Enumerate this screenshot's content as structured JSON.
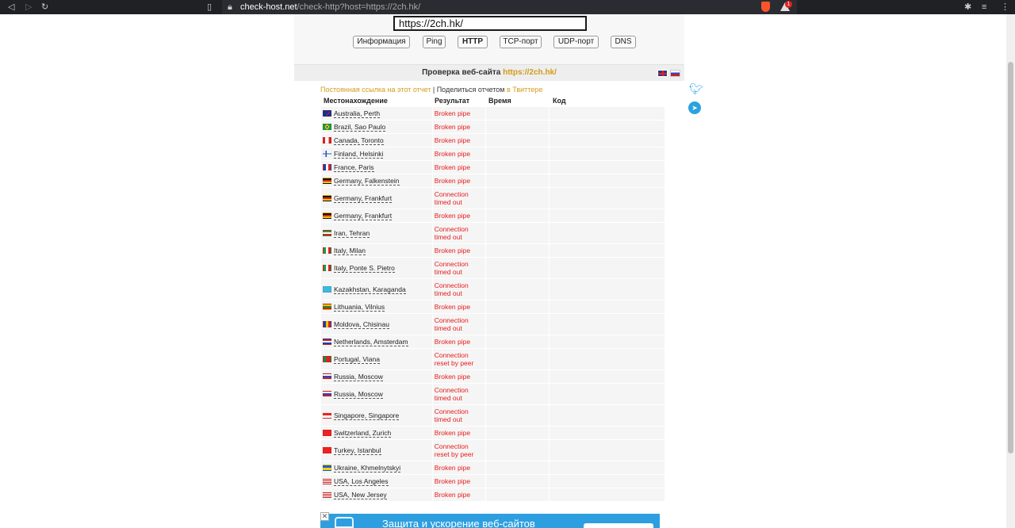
{
  "browser": {
    "url_host": "check-host.net",
    "url_path": "/check-http?host=https://2ch.hk/",
    "alert_count": "1"
  },
  "search": {
    "value": "https://2ch.hk/"
  },
  "tabs": [
    "Информация",
    "Ping",
    "HTTP",
    "TCP-порт",
    "UDP-порт",
    "DNS"
  ],
  "panel": {
    "title_prefix": "Проверка веб-сайта",
    "title_link": "https://2ch.hk/",
    "permalink": "Постоянная ссылка на этот отчет",
    "separator": "|",
    "share_text": "Поделиться отчетом",
    "share_link": "в Твиттере"
  },
  "columns": [
    "Местонахождение",
    "Результат",
    "Время",
    "Код"
  ],
  "rows": [
    {
      "location": "Australia, Perth",
      "result": "Broken pipe",
      "flag": "au"
    },
    {
      "location": "Brazil, Sao Paulo",
      "result": "Broken pipe",
      "flag": "br"
    },
    {
      "location": "Canada, Toronto",
      "result": "Broken pipe",
      "flag": "ca"
    },
    {
      "location": "Finland, Helsinki",
      "result": "Broken pipe",
      "flag": "fi"
    },
    {
      "location": "France, Paris",
      "result": "Broken pipe",
      "flag": "fr"
    },
    {
      "location": "Germany, Falkenstein",
      "result": "Broken pipe",
      "flag": "de"
    },
    {
      "location": "Germany, Frankfurt",
      "result": "Connection timed out",
      "flag": "de"
    },
    {
      "location": "Germany, Frankfurt",
      "result": "Broken pipe",
      "flag": "de"
    },
    {
      "location": "Iran, Tehran",
      "result": "Connection timed out",
      "flag": "ir"
    },
    {
      "location": "Italy, Milan",
      "result": "Broken pipe",
      "flag": "it"
    },
    {
      "location": "Italy, Ponte S. Pietro",
      "result": "Connection timed out",
      "flag": "it"
    },
    {
      "location": "Kazakhstan, Karaganda",
      "result": "Connection timed out",
      "flag": "kz"
    },
    {
      "location": "Lithuania, Vilnius",
      "result": "Broken pipe",
      "flag": "lt"
    },
    {
      "location": "Moldova, Chisinau",
      "result": "Connection timed out",
      "flag": "md"
    },
    {
      "location": "Netherlands, Amsterdam",
      "result": "Broken pipe",
      "flag": "nl"
    },
    {
      "location": "Portugal, Viana",
      "result": "Connection reset by peer",
      "flag": "pt"
    },
    {
      "location": "Russia, Moscow",
      "result": "Broken pipe",
      "flag": "ru"
    },
    {
      "location": "Russia, Moscow",
      "result": "Connection timed out",
      "flag": "ru"
    },
    {
      "location": "Singapore, Singapore",
      "result": "Connection timed out",
      "flag": "sg"
    },
    {
      "location": "Switzerland, Zurich",
      "result": "Broken pipe",
      "flag": "ch"
    },
    {
      "location": "Turkey, Istanbul",
      "result": "Connection reset by peer",
      "flag": "tr"
    },
    {
      "location": "Ukraine, Khmelnytskyi",
      "result": "Broken pipe",
      "flag": "ua"
    },
    {
      "location": "USA, Los Angeles",
      "result": "Broken pipe",
      "flag": "us"
    },
    {
      "location": "USA, New Jersey",
      "result": "Broken pipe",
      "flag": "us"
    }
  ],
  "ad": {
    "text": "Защита и ускорение веб-сайтов",
    "close": "✕"
  },
  "colors": {
    "accent": "#d29b18",
    "error": "#e81c1c"
  }
}
